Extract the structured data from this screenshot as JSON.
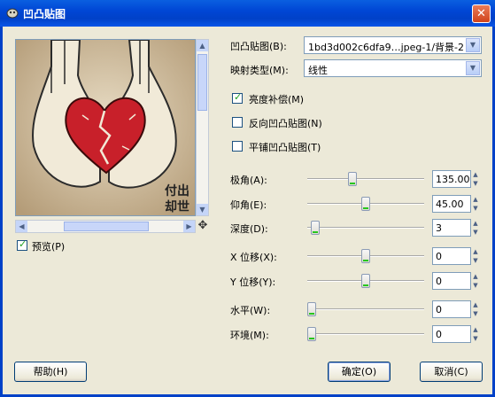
{
  "window": {
    "title": "凹凸贴图",
    "close_glyph": "✕"
  },
  "preview": {
    "checkbox_label": "预览(P)",
    "checked": true
  },
  "bumpmap": {
    "label": "凹凸贴图(B):",
    "value": "1bd3d002c6dfa9…jpeg-1/背景-2"
  },
  "map_type": {
    "label": "映射类型(M):",
    "value": "线性"
  },
  "options": [
    {
      "label": "亮度补偿(M)",
      "checked": true
    },
    {
      "label": "反向凹凸贴图(N)",
      "checked": false
    },
    {
      "label": "平铺凹凸贴图(T)",
      "checked": false
    }
  ],
  "params": {
    "azimuth": {
      "label": "极角(A):",
      "value": "135.00",
      "fraction": 0.375
    },
    "elevation": {
      "label": "仰角(E):",
      "value": "45.00",
      "fraction": 0.5
    },
    "depth": {
      "label": "深度(D):",
      "value": "3",
      "fraction": 0.03
    },
    "x_offset": {
      "label": "X 位移(X):",
      "value": "0",
      "fraction": 0.5
    },
    "y_offset": {
      "label": "Y 位移(Y):",
      "value": "0",
      "fraction": 0.5
    },
    "waterlevel": {
      "label": "水平(W):",
      "value": "0",
      "fraction": 0.0
    },
    "ambient": {
      "label": "环境(M):",
      "value": "0",
      "fraction": 0.0
    }
  },
  "buttons": {
    "help": "帮助(H)",
    "ok": "确定(O)",
    "cancel": "取消(C)"
  },
  "preview_text": [
    "付出",
    "却世"
  ],
  "colors": {
    "titlebar": "#0046d5",
    "dialog_bg": "#ece9d8",
    "heart": "#c8202a"
  }
}
